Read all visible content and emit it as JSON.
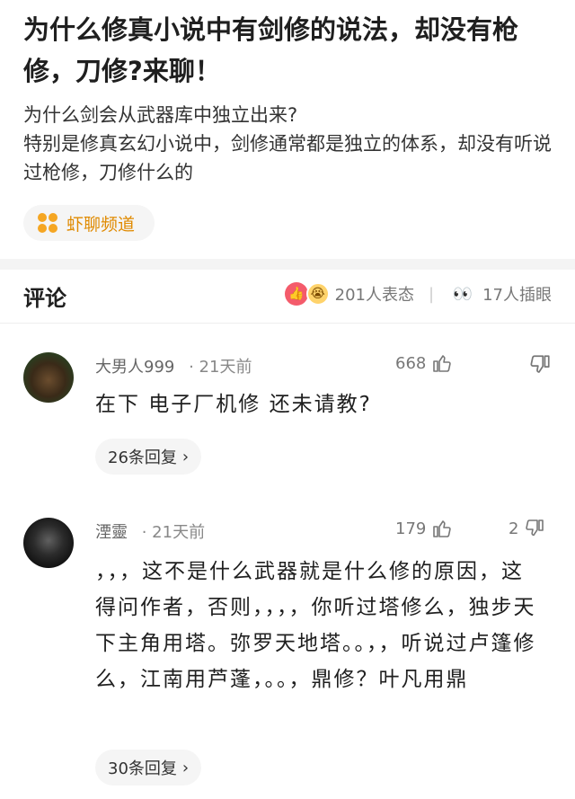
{
  "post": {
    "title": "为什么修真小说中有剑修的说法，却没有枪修，刀修?来聊！",
    "body": [
      "为什么剑会从武器库中独立出来?",
      "特别是修真玄幻小说中，剑修通常都是独立的体系，却没有听说过枪修，刀修什么的"
    ],
    "channel": "虾聊频道"
  },
  "comments_header": {
    "title": "评论",
    "reaction_1": "201人表态",
    "reaction_2": "17人插眼"
  },
  "comments": [
    {
      "user": "大男人999",
      "time": "· 21天前",
      "likes": "668",
      "dislikes": "",
      "text": "在下  电子厂机修    还未请教?",
      "replies": "26条回复"
    },
    {
      "user": "湮靈",
      "time": "· 21天前",
      "likes": "179",
      "dislikes": "2",
      "text": "，，，这不是什么武器就是什么修的原因，这得问作者，否则，，，，你听过塔修么，独步天下主角用塔。弥罗天地塔。。，，听说过卢篷修么，江南用芦蓬，。。，鼎修？叶凡用鼎",
      "replies": "30条回复"
    }
  ],
  "colors": {
    "accent": "#f5a623",
    "like": "#f45b6b",
    "text": "#1f1f1f",
    "muted": "#777777"
  }
}
